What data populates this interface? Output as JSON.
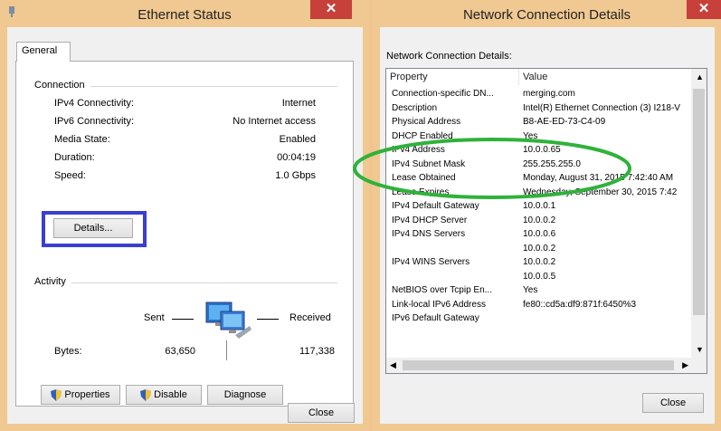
{
  "ethernet_status": {
    "title": "Ethernet Status",
    "close_glyph": "✕",
    "tab_general": "General",
    "connection_group": "Connection",
    "fields": [
      {
        "label": "IPv4 Connectivity:",
        "value": "Internet"
      },
      {
        "label": "IPv6 Connectivity:",
        "value": "No Internet access"
      },
      {
        "label": "Media State:",
        "value": "Enabled"
      },
      {
        "label": "Duration:",
        "value": "00:04:19"
      },
      {
        "label": "Speed:",
        "value": "1.0 Gbps"
      }
    ],
    "details_button": "Details...",
    "activity_group": "Activity",
    "sent_label": "Sent",
    "received_label": "Received",
    "bytes_label": "Bytes:",
    "bytes_sent": "63,650",
    "bytes_received": "117,338",
    "properties_button": "Properties",
    "disable_button": "Disable",
    "diagnose_button": "Diagnose",
    "close_button": "Close"
  },
  "network_details": {
    "title": "Network Connection Details",
    "close_glyph": "✕",
    "list_label": "Network Connection Details:",
    "columns": [
      "Property",
      "Value"
    ],
    "rows": [
      {
        "property": "Connection-specific DN...",
        "value": "merging.com"
      },
      {
        "property": "Description",
        "value": "Intel(R) Ethernet Connection (3) I218-V"
      },
      {
        "property": "Physical Address",
        "value": "B8-AE-ED-73-C4-09"
      },
      {
        "property": "DHCP Enabled",
        "value": "Yes"
      },
      {
        "property": "IPv4 Address",
        "value": "10.0.0.65"
      },
      {
        "property": "IPv4 Subnet Mask",
        "value": "255.255.255.0"
      },
      {
        "property": "Lease Obtained",
        "value": "Monday, August 31, 2015 7:42:40 AM"
      },
      {
        "property": "Lease Expires",
        "value": "Wednesday, September 30, 2015 7:42"
      },
      {
        "property": "IPv4 Default Gateway",
        "value": "10.0.0.1"
      },
      {
        "property": "IPv4 DHCP Server",
        "value": "10.0.0.2"
      },
      {
        "property": "IPv4 DNS Servers",
        "value": "10.0.0.6"
      },
      {
        "property": "",
        "value": "10.0.0.2"
      },
      {
        "property": "IPv4 WINS Servers",
        "value": "10.0.0.2"
      },
      {
        "property": "",
        "value": "10.0.0.5"
      },
      {
        "property": "NetBIOS over Tcpip En...",
        "value": "Yes"
      },
      {
        "property": "Link-local IPv6 Address",
        "value": "fe80::cd5a:df9:871f:6450%3"
      },
      {
        "property": "IPv6 Default Gateway",
        "value": ""
      }
    ],
    "close_button": "Close"
  },
  "colors": {
    "window_frame": "#f0c891",
    "close_red": "#c7403a",
    "highlight_blue": "#3a3fd0",
    "highlight_green": "#2fb23a"
  }
}
